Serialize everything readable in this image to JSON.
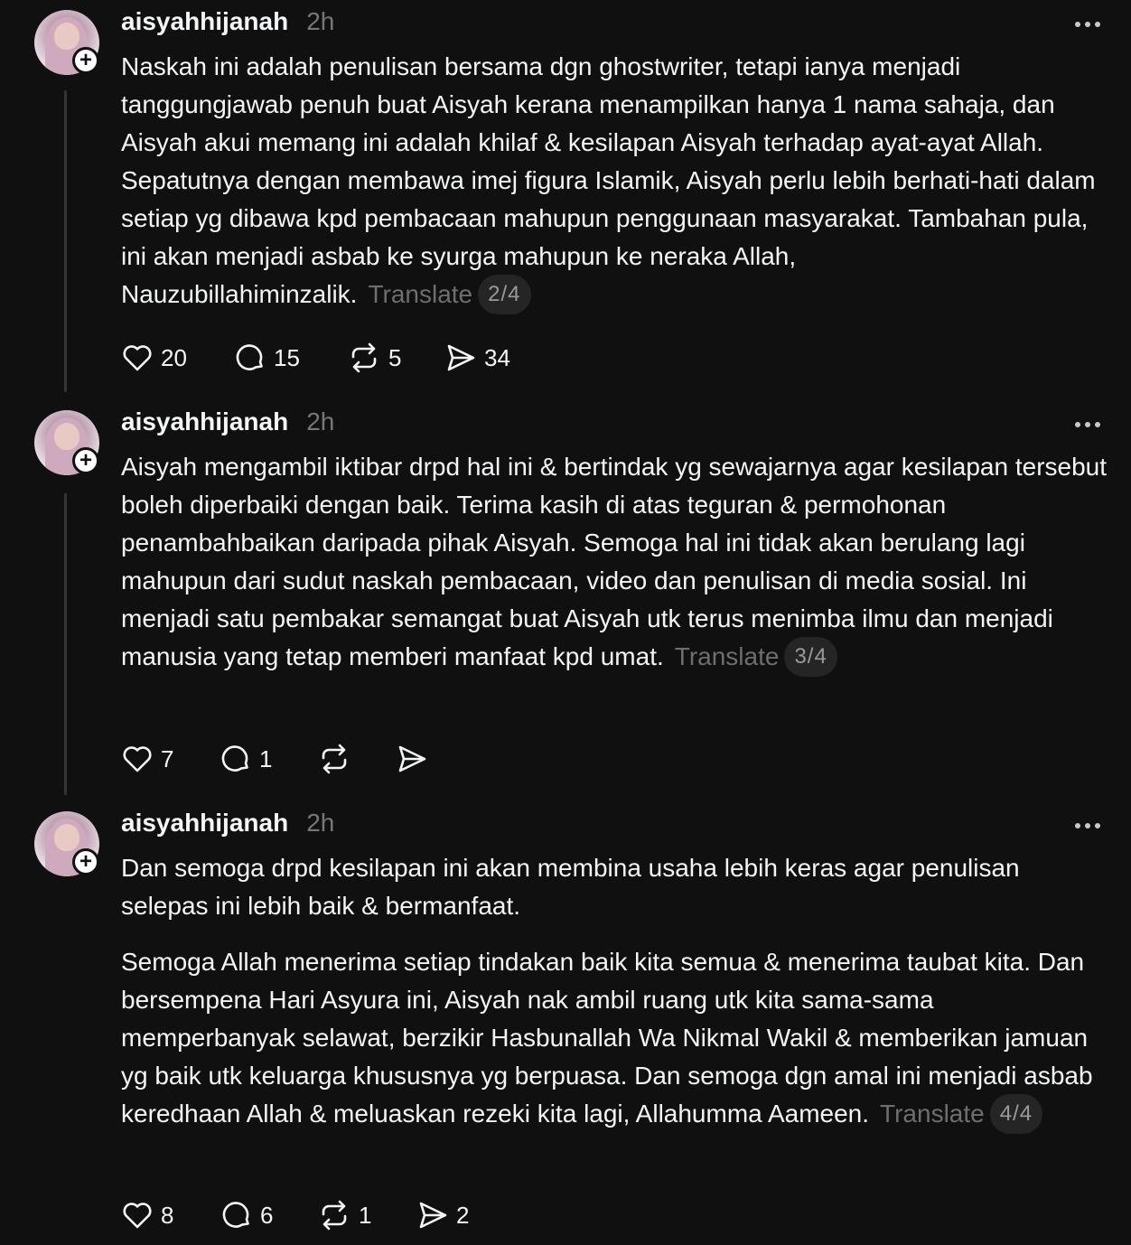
{
  "posts": [
    {
      "username": "aisyahhijanah",
      "time": "2h",
      "paragraphs": [
        "Naskah ini adalah penulisan bersama dgn ghostwriter, tetapi ianya menjadi tanggungjawab penuh buat Aisyah kerana menampilkan hanya 1 nama sahaja, dan Aisyah akui memang ini adalah khilaf & kesilapan Aisyah terhadap ayat-ayat Allah. Sepatutnya dengan membawa imej figura Islamik, Aisyah perlu lebih berhati-hati dalam setiap yg dibawa kpd pembacaan mahupun penggunaan masyarakat. Tambahan pula, ini akan menjadi asbab ke syurga mahupun ke neraka Allah, Nauzubillahiminzalik."
      ],
      "translate_label": "Translate",
      "thread_index": "2/4",
      "likes": "20",
      "replies": "15",
      "reposts": "5",
      "shares": "34"
    },
    {
      "username": "aisyahhijanah",
      "time": "2h",
      "paragraphs": [
        "Aisyah mengambil iktibar drpd hal ini & bertindak yg sewajarnya agar kesilapan tersebut boleh diperbaiki dengan baik. Terima kasih di atas teguran & permohonan penambahbaikan daripada pihak Aisyah. Semoga hal ini tidak akan berulang lagi mahupun dari sudut naskah pembacaan, video dan penulisan di media sosial. Ini menjadi satu pembakar semangat buat Aisyah utk terus menimba ilmu dan menjadi manusia yang tetap memberi manfaat kpd umat."
      ],
      "translate_label": "Translate",
      "thread_index": "3/4",
      "likes": "7",
      "replies": "1",
      "reposts": "",
      "shares": ""
    },
    {
      "username": "aisyahhijanah",
      "time": "2h",
      "paragraphs": [
        "Dan semoga drpd kesilapan ini akan membina usaha lebih keras agar penulisan selepas ini lebih baik & bermanfaat.",
        "Semoga Allah menerima setiap tindakan baik kita semua & menerima taubat kita. Dan bersempena Hari Asyura ini, Aisyah nak ambil ruang utk kita sama-sama memperbanyak selawat, berzikir Hasbunallah Wa Nikmal Wakil & memberikan jamuan yg baik utk keluarga khususnya yg berpuasa. Dan semoga dgn amal ini menjadi asbab keredhaan Allah & meluaskan rezeki kita lagi, Allahumma Aameen."
      ],
      "translate_label": "Translate",
      "thread_index": "4/4",
      "likes": "8",
      "replies": "6",
      "reposts": "1",
      "shares": "2"
    }
  ],
  "icons": {
    "like": "heart-icon",
    "reply": "comment-icon",
    "repost": "repost-icon",
    "share": "send-icon",
    "more": "more-dots-icon",
    "follow": "plus-icon"
  },
  "colors": {
    "background": "#101010",
    "text": "#f3f5f7",
    "muted": "#777777",
    "thread_line": "#333638",
    "pill": "#252525"
  }
}
